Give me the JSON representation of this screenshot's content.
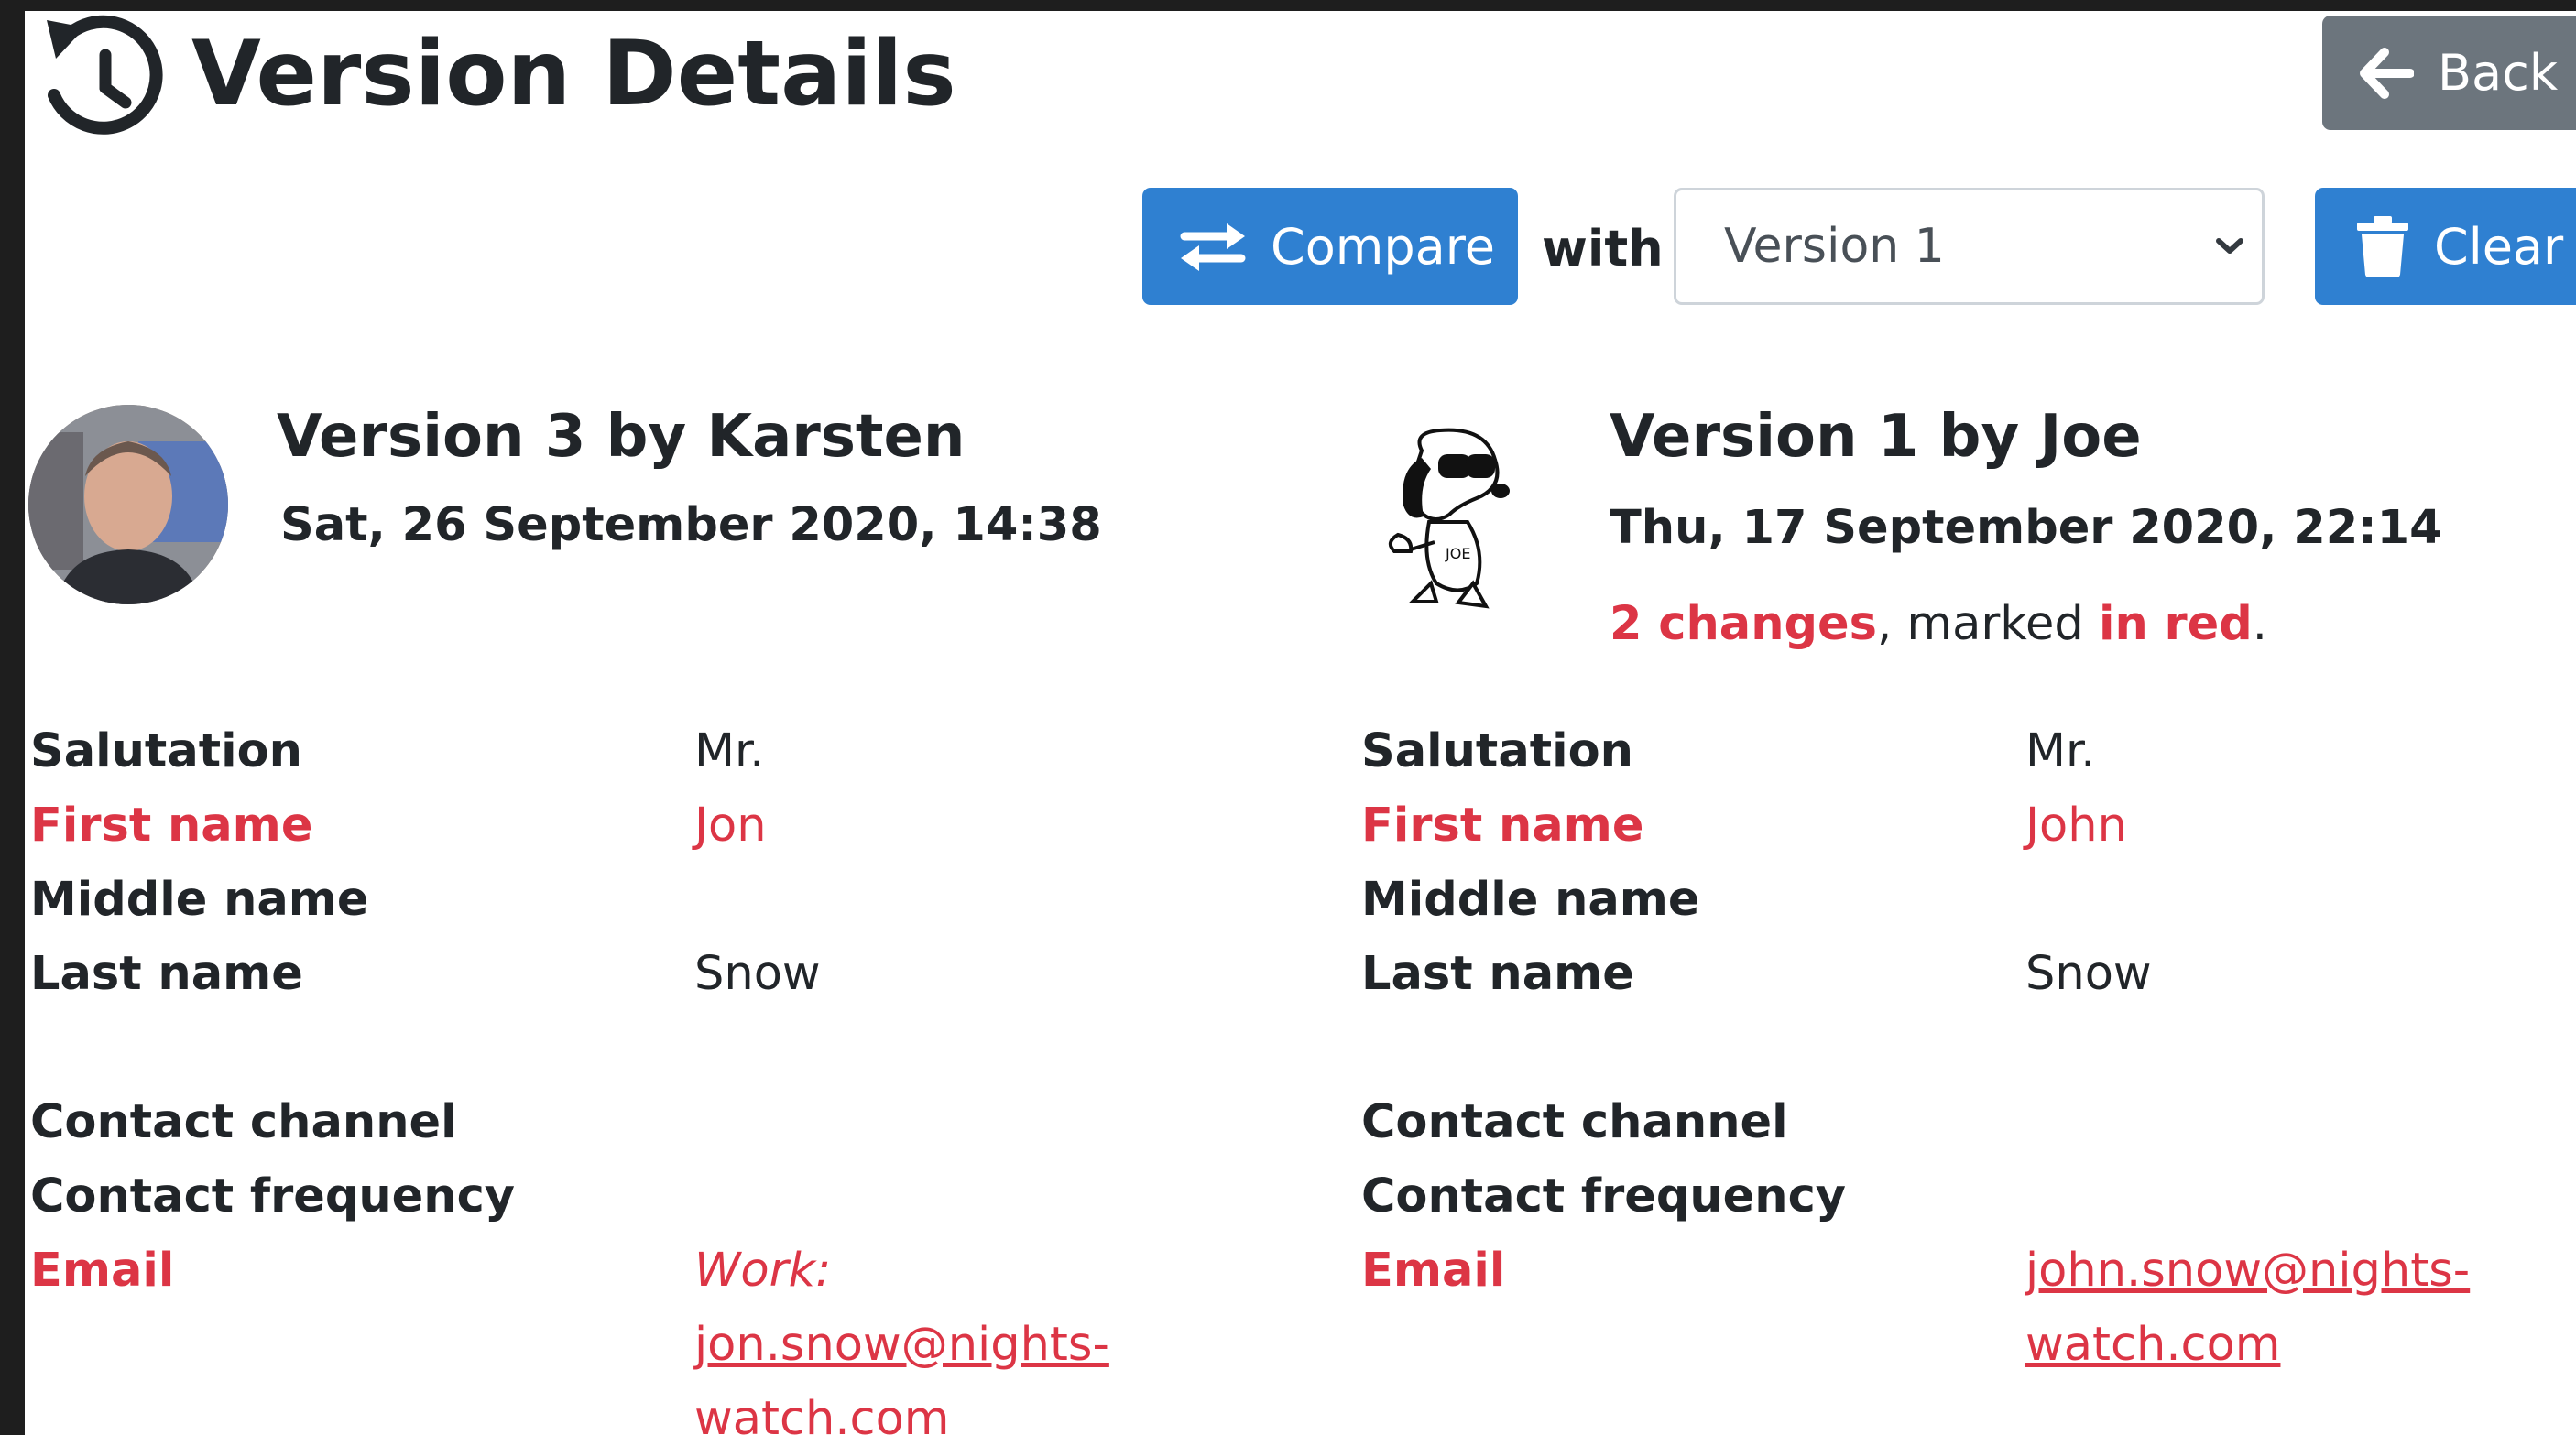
{
  "header": {
    "title": "Version Details",
    "back_label": "Back"
  },
  "toolbar": {
    "compare_label": "Compare",
    "with_label": "with",
    "select_value": "Version 1",
    "clear_label": "Clear"
  },
  "left_version": {
    "title": "Version 3 by Karsten",
    "date": "Sat, 26 September 2020, 14:38",
    "fields": {
      "salutation": {
        "label": "Salutation",
        "value": "Mr."
      },
      "first_name": {
        "label": "First name",
        "value": "Jon"
      },
      "middle_name": {
        "label": "Middle name",
        "value": ""
      },
      "last_name": {
        "label": "Last name",
        "value": "Snow"
      },
      "contact_channel": {
        "label": "Contact channel",
        "value": ""
      },
      "contact_frequency": {
        "label": "Contact frequency",
        "value": ""
      },
      "email": {
        "label": "Email",
        "type_label": "Work:",
        "value_line1": "jon.snow@nights-",
        "value_line2": "watch.com"
      }
    }
  },
  "right_version": {
    "title": "Version 1 by Joe",
    "date": "Thu, 17 September 2020, 22:14",
    "changes_count": "2 changes",
    "changes_mid": ", marked ",
    "changes_red": "in red",
    "changes_end": ".",
    "fields": {
      "salutation": {
        "label": "Salutation",
        "value": "Mr."
      },
      "first_name": {
        "label": "First name",
        "value": "John"
      },
      "middle_name": {
        "label": "Middle name",
        "value": ""
      },
      "last_name": {
        "label": "Last name",
        "value": "Snow"
      },
      "contact_channel": {
        "label": "Contact channel",
        "value": ""
      },
      "contact_frequency": {
        "label": "Contact frequency",
        "value": ""
      },
      "email": {
        "label": "Email",
        "value_line1": "john.snow@nights-",
        "value_line2": "watch.com"
      }
    }
  },
  "colors": {
    "changed": "#dc3545",
    "primary_button": "#2f80d1",
    "secondary_button": "#6c757d"
  },
  "icons": [
    "history-icon",
    "arrow-left-icon",
    "swap-arrows-icon",
    "chevron-down-icon",
    "trash-icon"
  ]
}
